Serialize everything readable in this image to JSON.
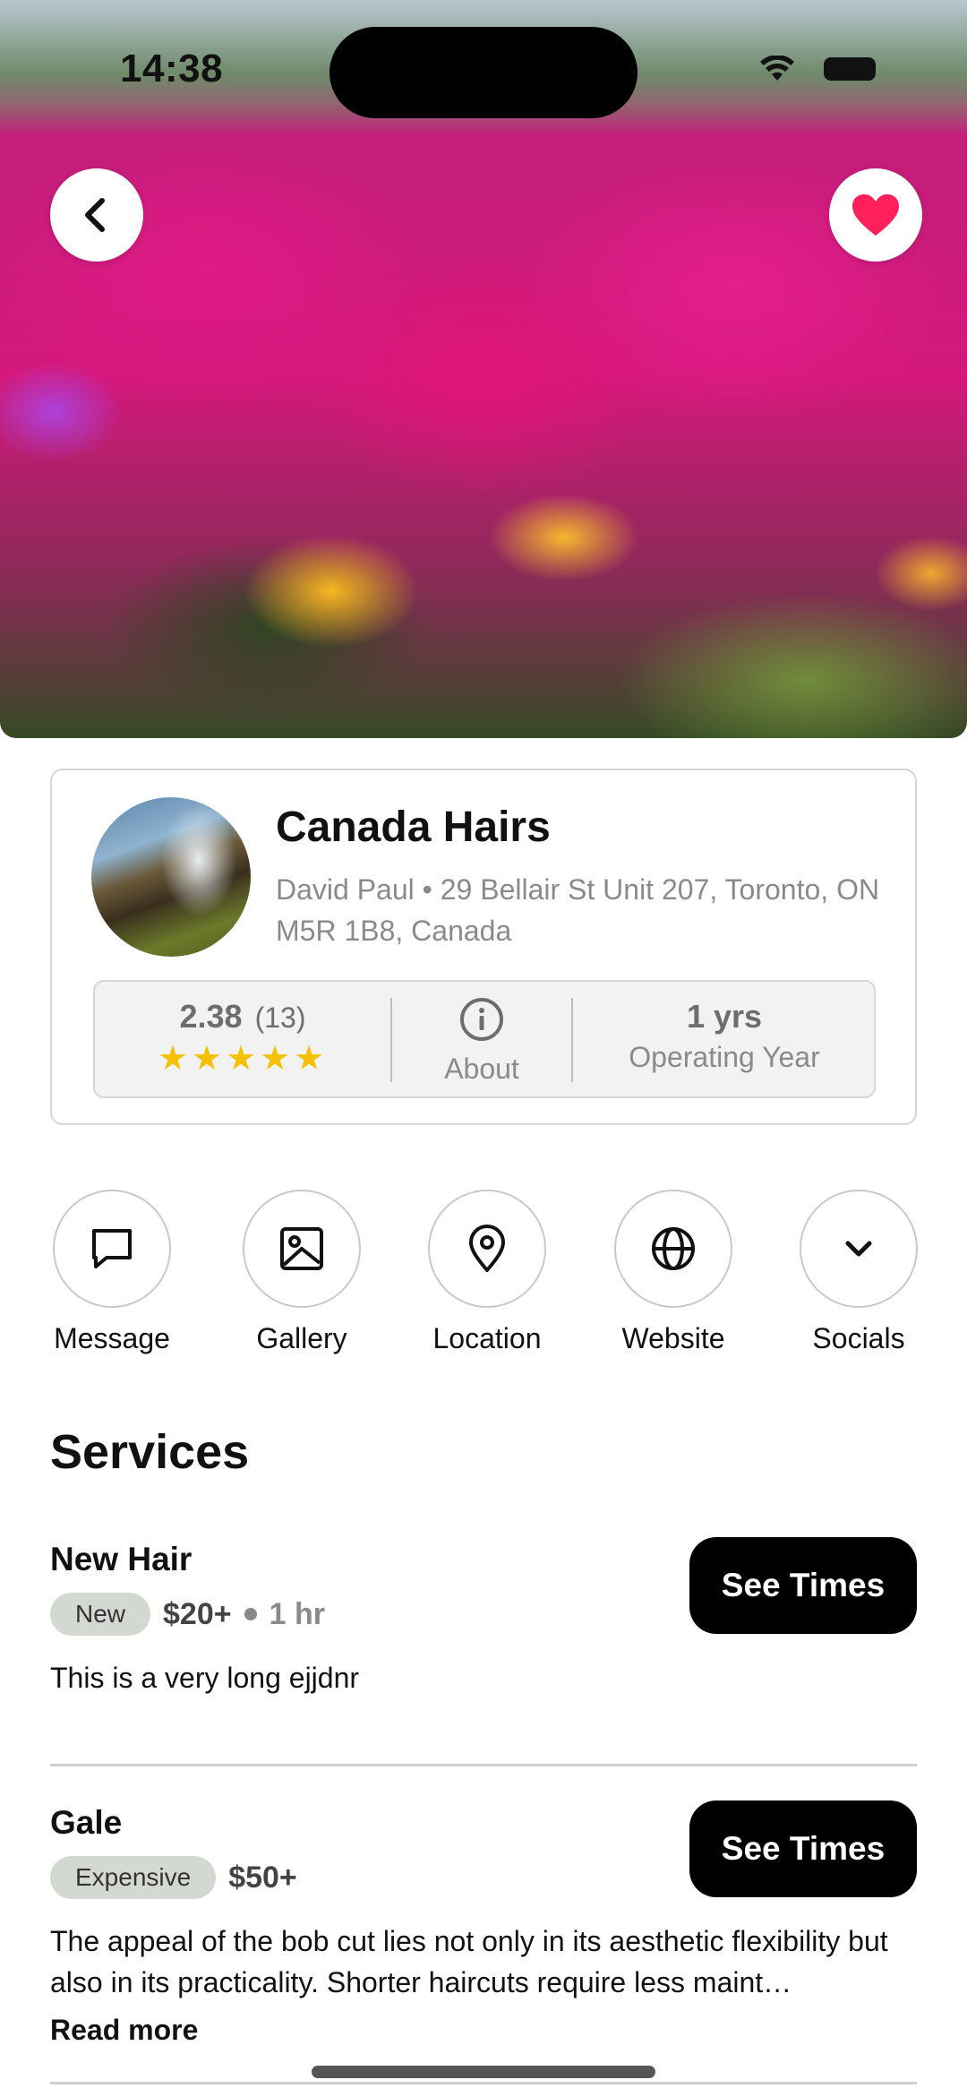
{
  "status_bar": {
    "time": "14:38"
  },
  "hero": {
    "back_icon": "chevron-left-icon",
    "favorite_icon": "heart-icon",
    "favorite_color": "#ff1f5a"
  },
  "business": {
    "name": "Canada Hairs",
    "address": "David Paul • 29 Bellair St Unit 207, Toronto, ON M5R 1B8, Canada",
    "rating": "2.38",
    "rating_count": "(13)",
    "stars": "★★★★★",
    "star_color": "#f5c000",
    "about_label": "About",
    "years_value": "1 yrs",
    "years_label": "Operating Year"
  },
  "actions": [
    {
      "label": "Message",
      "icon": "message-icon"
    },
    {
      "label": "Gallery",
      "icon": "image-icon"
    },
    {
      "label": "Location",
      "icon": "map-pin-icon"
    },
    {
      "label": "Website",
      "icon": "globe-icon"
    },
    {
      "label": "Socials",
      "icon": "chevron-down-icon"
    }
  ],
  "services": {
    "title": "Services",
    "items": [
      {
        "name": "New Hair",
        "badge": "New",
        "price": "$20+",
        "duration": "1 hr",
        "description": "This is a very long ejjdnr",
        "button": "See Times"
      },
      {
        "name": "Gale",
        "badge": "Expensive",
        "price": "$50+",
        "description": "The appeal of the bob cut lies not only in its aesthetic flexibility but also in its practicality. Shorter haircuts require less maint…",
        "read_more": "Read more",
        "button": "See Times"
      }
    ]
  }
}
